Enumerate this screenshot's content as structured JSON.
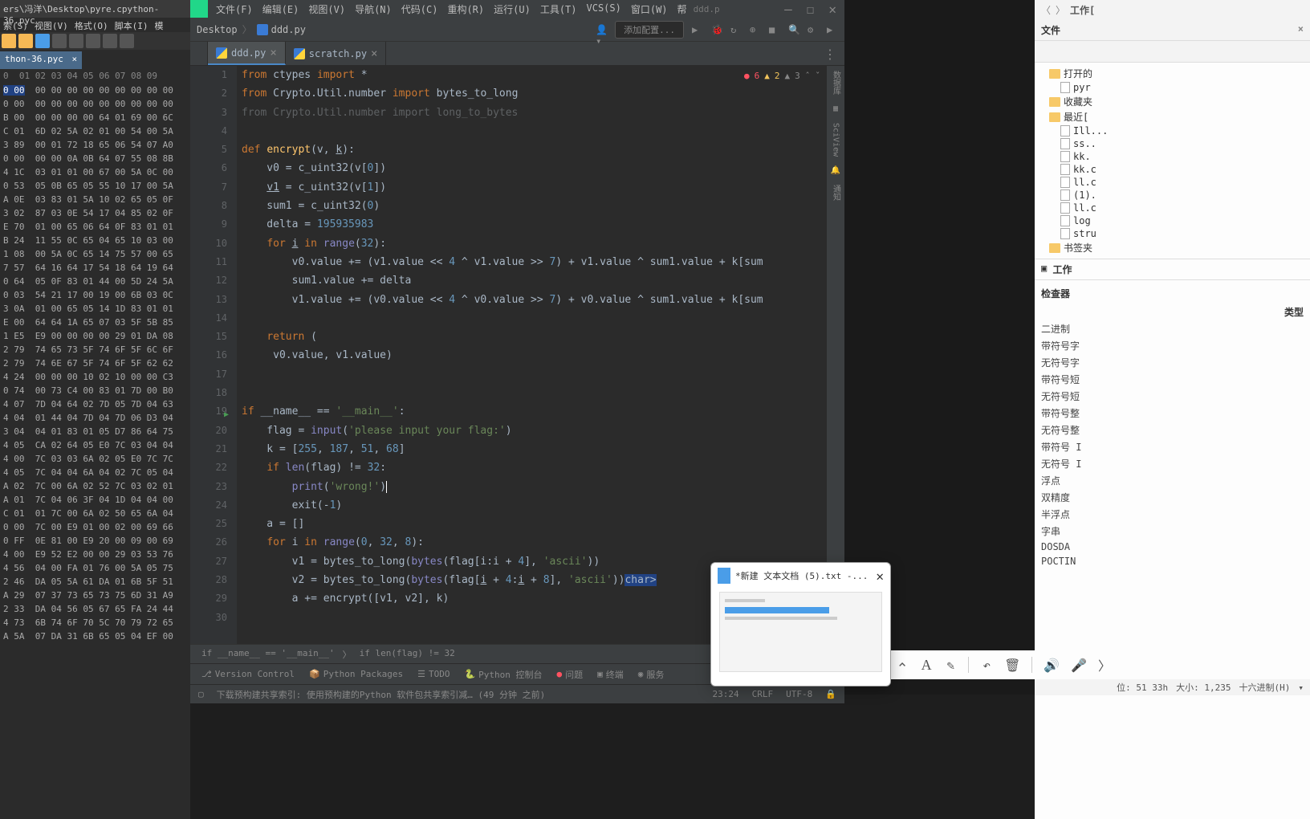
{
  "hex": {
    "title_path": "ers\\冯洋\\Desktop\\pyre.cpython-36.pyc",
    "menu": [
      "索(S)",
      "视图(V)",
      "格式(O)",
      "脚本(I)",
      "模"
    ],
    "tab": "thon-36.pyc",
    "columns": "0  01 02 03 04 05 06 07 08 09",
    "rows": [
      "0 00  00 00 00 00 00 00 00 00 00",
      "0 00  00 00 00 00 00 00 00 00 00",
      "B 00  00 00 00 00 64 01 69 00 6C",
      "C 01  6D 02 5A 02 01 00 54 00 5A",
      "3 89  00 01 72 18 65 06 54 07 A0",
      "0 00  00 00 0A 0B 64 07 55 08 8B",
      "4 1C  03 01 01 00 67 00 5A 0C 00",
      "0 53  05 0B 65 05 55 10 17 00 5A",
      "A 0E  03 83 01 5A 10 02 65 05 0F",
      "3 02  87 03 0E 54 17 04 85 02 0F",
      "E 70  01 00 65 06 64 0F 83 01 01",
      "B 24  11 55 0C 65 04 65 10 03 00",
      "1 08  00 5A 0C 65 14 75 57 00 65",
      "7 57  64 16 64 17 54 18 64 19 64",
      "0 64  05 0F 83 01 44 00 5D 24 5A",
      "0 03  54 21 17 00 19 00 6B 03 0C",
      "3 0A  01 00 65 05 14 1D 83 01 01",
      "E 00  64 64 1A 65 07 03 5F 5B 85",
      "1 E5  E9 00 00 00 00 29 01 DA 08",
      "2 79  74 65 73 5F 74 6F 5F 6C 6F",
      "2 79  74 6E 67 5F 74 6F 5F 62 62",
      "4 24  00 00 00 10 02 10 00 00 C3",
      "0 74  00 73 C4 00 83 01 7D 00 B0",
      "4 07  7D 04 64 02 7D 05 7D 04 63",
      "4 04  01 44 04 7D 04 7D 06 D3 04",
      "3 04  04 01 83 01 05 D7 86 64 75",
      "4 05  CA 02 64 05 E0 7C 03 04 04",
      "4 00  7C 03 03 6A 02 05 E0 7C 7C",
      "4 05  7C 04 04 6A 04 02 7C 05 04",
      "A 02  7C 00 6A 02 52 7C 03 02 01",
      "A 01  7C 04 06 3F 04 1D 04 04 00",
      "C 01  01 7C 00 6A 02 50 65 6A 04",
      "0 00  7C 00 E9 01 00 02 00 69 66",
      "0 FF  0E 81 00 E9 20 00 09 00 69",
      "4 00  E9 52 E2 00 00 29 03 53 76",
      "4 56  04 00 FA 01 76 00 5A 05 75",
      "2 46  DA 05 5A 61 DA 01 6B 5F 51",
      "A 29  07 37 73 65 73 75 6D 31 A9",
      "2 33  DA 04 56 05 67 65 FA 24 44",
      "4 73  6B 74 6F 70 5C 70 79 72 65",
      "A 5A  07 DA 31 6B 65 05 04 EF 00"
    ]
  },
  "ide": {
    "menu": [
      "文件(F)",
      "编辑(E)",
      "视图(V)",
      "导航(N)",
      "代码(C)",
      "重构(R)",
      "运行(U)",
      "工具(T)",
      "VCS(S)",
      "窗口(W)",
      "帮"
    ],
    "title_tail": "ddd.p",
    "crumb1": "Desktop",
    "crumb2": "ddd.py",
    "add_config": "添加配置...",
    "tabs": [
      {
        "label": "ddd.py",
        "active": true
      },
      {
        "label": "scratch.py",
        "active": false
      }
    ],
    "inspections": {
      "errors": "6",
      "warnings": "2",
      "typos": "3"
    },
    "breadcrumbs": [
      "if __name__ == '__main__'",
      "if len(flag) != 32"
    ],
    "lines": [
      1,
      2,
      3,
      4,
      5,
      6,
      7,
      8,
      9,
      10,
      11,
      12,
      13,
      14,
      15,
      16,
      17,
      18,
      19,
      20,
      21,
      22,
      23,
      24,
      25,
      26,
      27,
      28,
      29,
      30
    ],
    "bottom_tools": [
      "Version Control",
      "Python Packages",
      "TODO",
      "Python 控制台",
      "问题",
      "终端",
      "服务"
    ],
    "status_msg": "下载预构建共享索引: 使用预构建的Python 软件包共享索引减…  (49 分钟 之前)",
    "status_right": [
      "23:24",
      "CRLF",
      "UTF-8"
    ]
  },
  "rside": {
    "header": "工作[",
    "sections": {
      "files": "文件",
      "x": "×"
    },
    "tree": [
      {
        "type": "folder",
        "label": "打开的",
        "lvl": 1
      },
      {
        "type": "file",
        "label": "pyr",
        "lvl": 2
      },
      {
        "type": "folder",
        "label": "收藏夹",
        "lvl": 1
      },
      {
        "type": "folder",
        "label": "最近[",
        "lvl": 1
      },
      {
        "type": "file",
        "label": "Ill...",
        "lvl": 2
      },
      {
        "type": "file",
        "label": "ss..",
        "lvl": 2
      },
      {
        "type": "file",
        "label": "kk.",
        "lvl": 2
      },
      {
        "type": "file",
        "label": "kk.c",
        "lvl": 2
      },
      {
        "type": "file",
        "label": "ll.c",
        "lvl": 2
      },
      {
        "type": "file",
        "label": "(1).",
        "lvl": 2
      },
      {
        "type": "file",
        "label": "ll.c",
        "lvl": 2
      },
      {
        "type": "file",
        "label": "log",
        "lvl": 2
      },
      {
        "type": "file",
        "label": "stru",
        "lvl": 2
      },
      {
        "type": "folder",
        "label": "书签夹",
        "lvl": 1
      }
    ],
    "mid": "工作",
    "inspector_hdr": "检查器",
    "kind_hdr": "类型",
    "kinds": [
      "二进制",
      "带符号字",
      "无符号字",
      "带符号短",
      "无符号短",
      "带符号整",
      "无符号整",
      "带符号 I",
      "无符号 I",
      "浮点",
      "双精度",
      "半浮点",
      "字串",
      "DOSDA",
      "POCTIN"
    ]
  },
  "actionbar_icons": [
    "arrow-up-icon",
    "font-icon",
    "wand-icon",
    "undo-icon",
    "delete-icon",
    "speaker-icon",
    "mic-icon",
    "more-icon"
  ],
  "rstatus": {
    "pos": "位: 51 33h",
    "size": "大小: 1,235",
    "mode": "十六进制(H)"
  },
  "popup": {
    "title": "*新建 文本文档 (5).txt -..."
  }
}
